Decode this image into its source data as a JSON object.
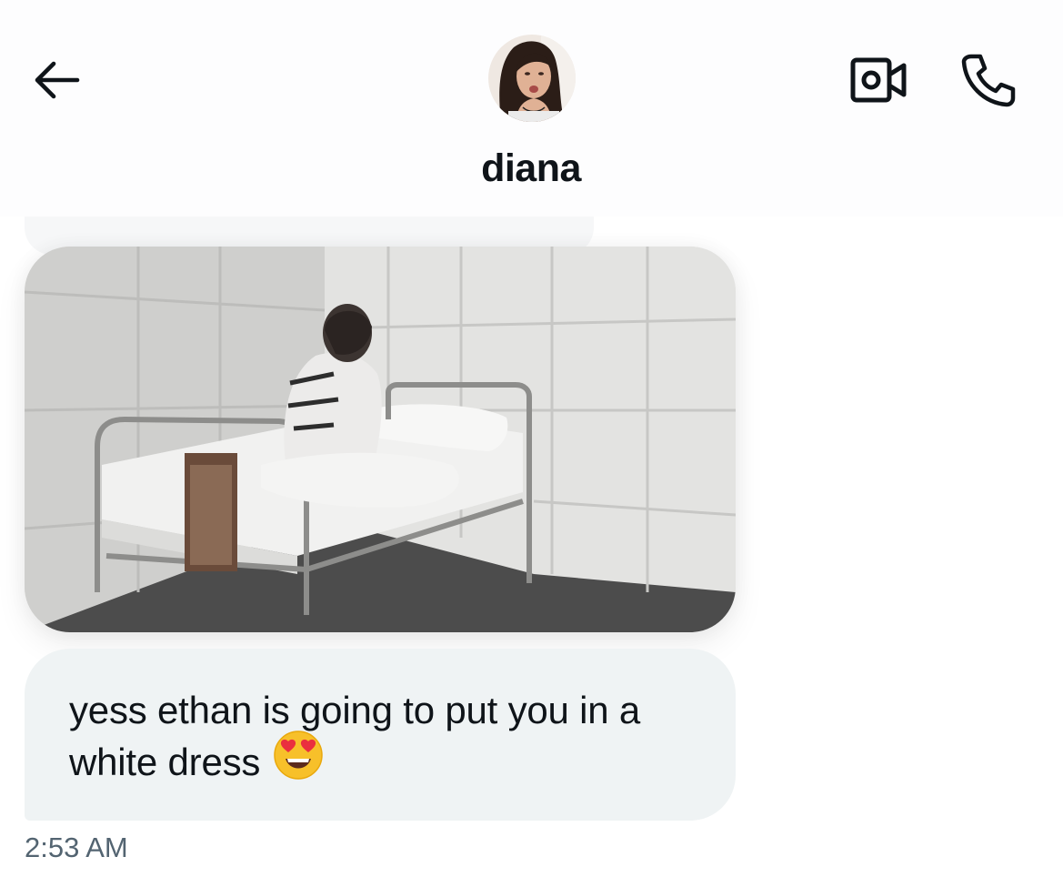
{
  "header": {
    "contact_name": "diana",
    "back_icon": "arrow-left-icon",
    "video_icon": "video-camera-icon",
    "voice_icon": "phone-icon"
  },
  "messages": [
    {
      "type": "image",
      "alt": "photo"
    },
    {
      "type": "text",
      "text": "yess ethan is going to put you in a white dress",
      "emoji": "😍"
    }
  ],
  "timestamp": "2:53 AM",
  "colors": {
    "bubble": "#eff3f4",
    "text": "#0f1419",
    "muted": "#536471"
  }
}
